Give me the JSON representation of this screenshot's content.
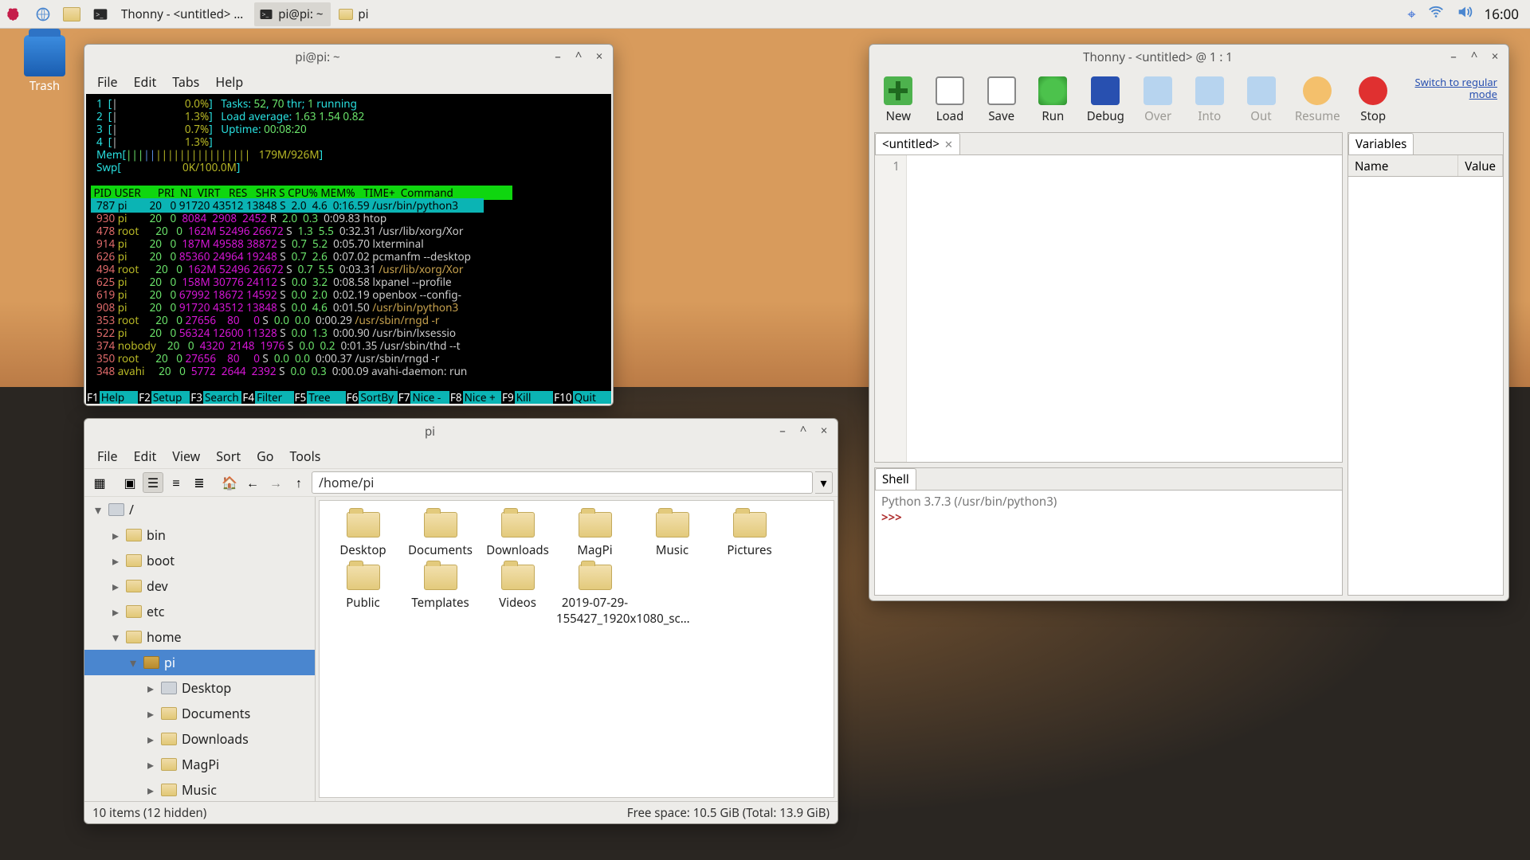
{
  "taskbar": {
    "tasks": [
      {
        "label": "Thonny  -  <untitled>  …"
      },
      {
        "label": "pi@pi: ~"
      },
      {
        "label": "pi"
      }
    ],
    "clock": "16:00"
  },
  "desktop": {
    "trash_label": "Trash"
  },
  "terminal": {
    "title": "pi@pi: ~",
    "menus": [
      "File",
      "Edit",
      "Tabs",
      "Help"
    ],
    "summary": {
      "cpu_rows": [
        {
          "n": "1",
          "pct": "0.0%"
        },
        {
          "n": "2",
          "pct": "1.3%"
        },
        {
          "n": "3",
          "pct": "0.7%"
        },
        {
          "n": "4",
          "pct": "1.3%"
        }
      ],
      "mem": "179M/926M",
      "swp": "0K/100.0M",
      "tasks": "52",
      "threads": "70",
      "running": "1",
      "load": "1.63 1.54 0.82",
      "uptime": "00:08:20"
    },
    "header": " PID USER      PRI  NI  VIRT   RES   SHR S CPU% MEM%   TIME+  Command",
    "rows": [
      {
        "sel": true,
        "pid": "787",
        "user": "pi",
        "pri": "20",
        "ni": "0",
        "virt": "91720",
        "res": "43512",
        "shr": "13848",
        "s": "S",
        "cpu": "2.0",
        "mem": "4.6",
        "time": "0:16.59",
        "cmd": "/usr/bin/python3",
        "cmdC": ""
      },
      {
        "pid": "930",
        "user": "pi",
        "pri": "20",
        "ni": "0",
        "virt": "8084",
        "res": "2908",
        "shr": "2452",
        "s": "R",
        "cpu": "2.0",
        "mem": "0.3",
        "time": "0:09.83",
        "cmd": "htop",
        "cmdC": "gr"
      },
      {
        "pid": "478",
        "user": "root",
        "pri": "20",
        "ni": "0",
        "virt": "162M",
        "res": "52496",
        "shr": "26672",
        "s": "S",
        "cpu": "1.3",
        "mem": "5.5",
        "time": "0:32.31",
        "cmd": "/usr/lib/xorg/Xor",
        "cmdC": "gr"
      },
      {
        "pid": "914",
        "user": "pi",
        "pri": "20",
        "ni": "0",
        "virt": "187M",
        "res": "49588",
        "shr": "38872",
        "s": "S",
        "cpu": "0.7",
        "mem": "5.2",
        "time": "0:05.70",
        "cmd": "lxterminal",
        "cmdC": "gr"
      },
      {
        "pid": "626",
        "user": "pi",
        "pri": "20",
        "ni": "0",
        "virt": "85360",
        "res": "24964",
        "shr": "19248",
        "s": "S",
        "cpu": "0.7",
        "mem": "2.6",
        "time": "0:07.02",
        "cmd": "pcmanfm --desktop",
        "cmdC": "gr"
      },
      {
        "pid": "494",
        "user": "root",
        "pri": "20",
        "ni": "0",
        "virt": "162M",
        "res": "52496",
        "shr": "26672",
        "s": "S",
        "cpu": "0.7",
        "mem": "5.5",
        "time": "0:03.31",
        "cmd": "/usr/lib/xorg/Xor",
        "cmdC": "or"
      },
      {
        "pid": "625",
        "user": "pi",
        "pri": "20",
        "ni": "0",
        "virt": "158M",
        "res": "30776",
        "shr": "24112",
        "s": "S",
        "cpu": "0.0",
        "mem": "3.2",
        "time": "0:08.58",
        "cmd": "lxpanel --profile",
        "cmdC": "gr"
      },
      {
        "pid": "619",
        "user": "pi",
        "pri": "20",
        "ni": "0",
        "virt": "67992",
        "res": "18672",
        "shr": "14592",
        "s": "S",
        "cpu": "0.0",
        "mem": "2.0",
        "time": "0:02.19",
        "cmd": "openbox --config-",
        "cmdC": "gr"
      },
      {
        "pid": "908",
        "user": "pi",
        "pri": "20",
        "ni": "0",
        "virt": "91720",
        "res": "43512",
        "shr": "13848",
        "s": "S",
        "cpu": "0.0",
        "mem": "4.6",
        "time": "0:01.50",
        "cmd": "/usr/bin/python3",
        "cmdC": "or"
      },
      {
        "pid": "353",
        "user": "root",
        "pri": "20",
        "ni": "0",
        "virt": "27656",
        "res": "80",
        "shr": "0",
        "s": "S",
        "cpu": "0.0",
        "mem": "0.0",
        "time": "0:00.29",
        "cmd": "/usr/sbin/rngd -r",
        "cmdC": "or"
      },
      {
        "pid": "522",
        "user": "pi",
        "pri": "20",
        "ni": "0",
        "virt": "56324",
        "res": "12600",
        "shr": "11328",
        "s": "S",
        "cpu": "0.0",
        "mem": "1.3",
        "time": "0:00.90",
        "cmd": "/usr/bin/lxsessio",
        "cmdC": "gr"
      },
      {
        "pid": "374",
        "user": "nobody",
        "pri": "20",
        "ni": "0",
        "virt": "4320",
        "res": "2148",
        "shr": "1976",
        "s": "S",
        "cpu": "0.0",
        "mem": "0.2",
        "time": "0:01.35",
        "cmd": "/usr/sbin/thd --t",
        "cmdC": "gr"
      },
      {
        "pid": "350",
        "user": "root",
        "pri": "20",
        "ni": "0",
        "virt": "27656",
        "res": "80",
        "shr": "0",
        "s": "S",
        "cpu": "0.0",
        "mem": "0.0",
        "time": "0:00.37",
        "cmd": "/usr/sbin/rngd -r",
        "cmdC": "gr"
      },
      {
        "pid": "348",
        "user": "avahi",
        "pri": "20",
        "ni": "0",
        "virt": "5772",
        "res": "2644",
        "shr": "2392",
        "s": "S",
        "cpu": "0.0",
        "mem": "0.3",
        "time": "0:00.09",
        "cmd": "avahi-daemon: run",
        "cmdC": "gr"
      }
    ],
    "fkeys": [
      {
        "k": "F1",
        "a": "Help"
      },
      {
        "k": "F2",
        "a": "Setup"
      },
      {
        "k": "F3",
        "a": "Search"
      },
      {
        "k": "F4",
        "a": "Filter"
      },
      {
        "k": "F5",
        "a": "Tree"
      },
      {
        "k": "F6",
        "a": "SortBy"
      },
      {
        "k": "F7",
        "a": "Nice -"
      },
      {
        "k": "F8",
        "a": "Nice +"
      },
      {
        "k": "F9",
        "a": "Kill"
      },
      {
        "k": "F10",
        "a": "Quit"
      }
    ]
  },
  "filemanager": {
    "title": "pi",
    "menus": [
      "File",
      "Edit",
      "View",
      "Sort",
      "Go",
      "Tools"
    ],
    "path": "/home/pi",
    "tree": [
      {
        "d": 0,
        "exp": "▾",
        "ico": "drive",
        "label": "/"
      },
      {
        "d": 1,
        "exp": "▸",
        "ico": "folder",
        "label": "bin"
      },
      {
        "d": 1,
        "exp": "▸",
        "ico": "folder",
        "label": "boot"
      },
      {
        "d": 1,
        "exp": "▸",
        "ico": "folder",
        "label": "dev"
      },
      {
        "d": 1,
        "exp": "▸",
        "ico": "folder",
        "label": "etc"
      },
      {
        "d": 1,
        "exp": "▾",
        "ico": "folder",
        "label": "home"
      },
      {
        "d": 2,
        "exp": "▾",
        "ico": "folder-open",
        "label": "pi",
        "sel": true
      },
      {
        "d": 3,
        "exp": "▸",
        "ico": "drive",
        "label": "Desktop"
      },
      {
        "d": 3,
        "exp": "▸",
        "ico": "folder",
        "label": "Documents"
      },
      {
        "d": 3,
        "exp": "▸",
        "ico": "folder",
        "label": "Downloads"
      },
      {
        "d": 3,
        "exp": "▸",
        "ico": "folder",
        "label": "MagPi"
      },
      {
        "d": 3,
        "exp": "▸",
        "ico": "folder",
        "label": "Music"
      }
    ],
    "items": [
      {
        "label": "Desktop"
      },
      {
        "label": "Documents"
      },
      {
        "label": "Downloads"
      },
      {
        "label": "MagPi"
      },
      {
        "label": "Music"
      },
      {
        "label": "Pictures"
      },
      {
        "label": "Public"
      },
      {
        "label": "Templates"
      },
      {
        "label": "Videos"
      },
      {
        "label": "2019-07-29-155427_1920x1080_sc…"
      }
    ],
    "status_left": "10 items (12 hidden)",
    "status_right": "Free space: 10.5 GiB (Total: 13.9 GiB)"
  },
  "thonny": {
    "title": "Thonny  -  <untitled>  @  1 : 1",
    "switch_link": "Switch to\nregular mode",
    "buttons": [
      {
        "label": "New",
        "ico": "i-new",
        "dis": false
      },
      {
        "label": "Load",
        "ico": "i-file",
        "dis": false
      },
      {
        "label": "Save",
        "ico": "i-file",
        "dis": false
      },
      {
        "label": "Run",
        "ico": "i-run",
        "dis": false
      },
      {
        "label": "Debug",
        "ico": "i-debug",
        "dis": false
      },
      {
        "label": "Over",
        "ico": "i-step",
        "dis": true
      },
      {
        "label": "Into",
        "ico": "i-step",
        "dis": true
      },
      {
        "label": "Out",
        "ico": "i-step",
        "dis": true
      },
      {
        "label": "Resume",
        "ico": "i-resume",
        "dis": true
      },
      {
        "label": "Stop",
        "ico": "i-stop",
        "dis": false
      }
    ],
    "editor_tab": "<untitled>",
    "gutter_line": "1",
    "shell_tab": "Shell",
    "shell_line1": "Python 3.7.3 (/usr/bin/python3)",
    "shell_prompt": ">>>",
    "vars_tab": "Variables",
    "vars_col1": "Name",
    "vars_col2": "Value"
  }
}
